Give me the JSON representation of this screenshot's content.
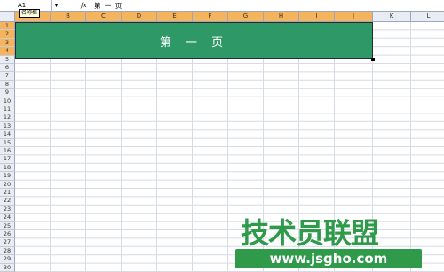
{
  "formula_bar": {
    "name_box": "A1",
    "dropdown": "▾",
    "fx": "fx",
    "formula": "第 一 页",
    "tooltip": "名称框"
  },
  "columns": [
    "B",
    "C",
    "D",
    "E",
    "F",
    "G",
    "H",
    "I",
    "J",
    "K",
    "L"
  ],
  "first_column": "A",
  "rows": [
    "1",
    "2",
    "3",
    "4",
    "5",
    "6",
    "7",
    "8",
    "9",
    "10",
    "11",
    "12",
    "13",
    "14",
    "15",
    "16",
    "17",
    "18",
    "19",
    "20",
    "21",
    "22",
    "23",
    "24",
    "25",
    "26",
    "27",
    "28",
    "29",
    "30"
  ],
  "selected_rows": 4,
  "selected_columns": 10,
  "merged_cell": {
    "text": "第 一 页",
    "fill_color": "#2e9967"
  },
  "watermark": {
    "title": "技术员联盟",
    "url": "www.jsgho.com",
    "color": "#2e9a4a"
  },
  "colors": {
    "header_selected": "#f5b45c",
    "header_normal": "#e9ecf2",
    "gridline": "#d6dbe4"
  }
}
